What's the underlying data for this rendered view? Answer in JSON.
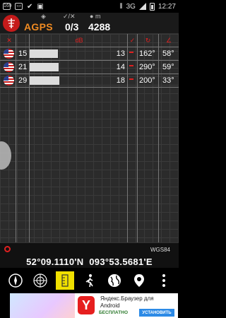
{
  "statusbar": {
    "left_icons": [
      "169",
      "image",
      "check",
      "bag"
    ],
    "network": "3G",
    "time": "12:27"
  },
  "header": {
    "agps_label": "AGPS",
    "sat_count": "0/3",
    "altitude": "4288",
    "icons": [
      "satellite-icon",
      "check-x-icon",
      "altitude-icon"
    ],
    "altitude_unit": "m"
  },
  "columns": {
    "signal": "dB",
    "used": "✓",
    "azimuth": "↻",
    "elevation": "∠"
  },
  "satellites": [
    {
      "prn": "15",
      "snr": "13",
      "snr_level": 0.08,
      "azimuth": "162°",
      "elevation": "58°"
    },
    {
      "prn": "21",
      "snr": "14",
      "snr_level": 0.1,
      "azimuth": "290°",
      "elevation": "59°"
    },
    {
      "prn": "29",
      "snr": "18",
      "snr_level": 0.15,
      "azimuth": "200°",
      "elevation": "33°"
    }
  ],
  "coordinates": {
    "datum": "WGS84",
    "lat": "52°09.1110'N",
    "lon": "093°53.5681'E"
  },
  "toolbar": [
    "compass-icon",
    "radar-icon",
    "ruler-icon",
    "walk-icon",
    "globe-icon",
    "location-pin-icon",
    "menu-icon"
  ],
  "ad": {
    "title": "Яндекс.Браузер для Android",
    "free_label": "БЕСПЛАТНО",
    "install_label": "УСТАНОВИТЬ",
    "logo_letter": "Y",
    "brand": "Yandex",
    "accent": "#e61f1f"
  },
  "colors": {
    "accent": "#f08b22",
    "alert": "#e02020",
    "background": "#2b2b2b"
  }
}
